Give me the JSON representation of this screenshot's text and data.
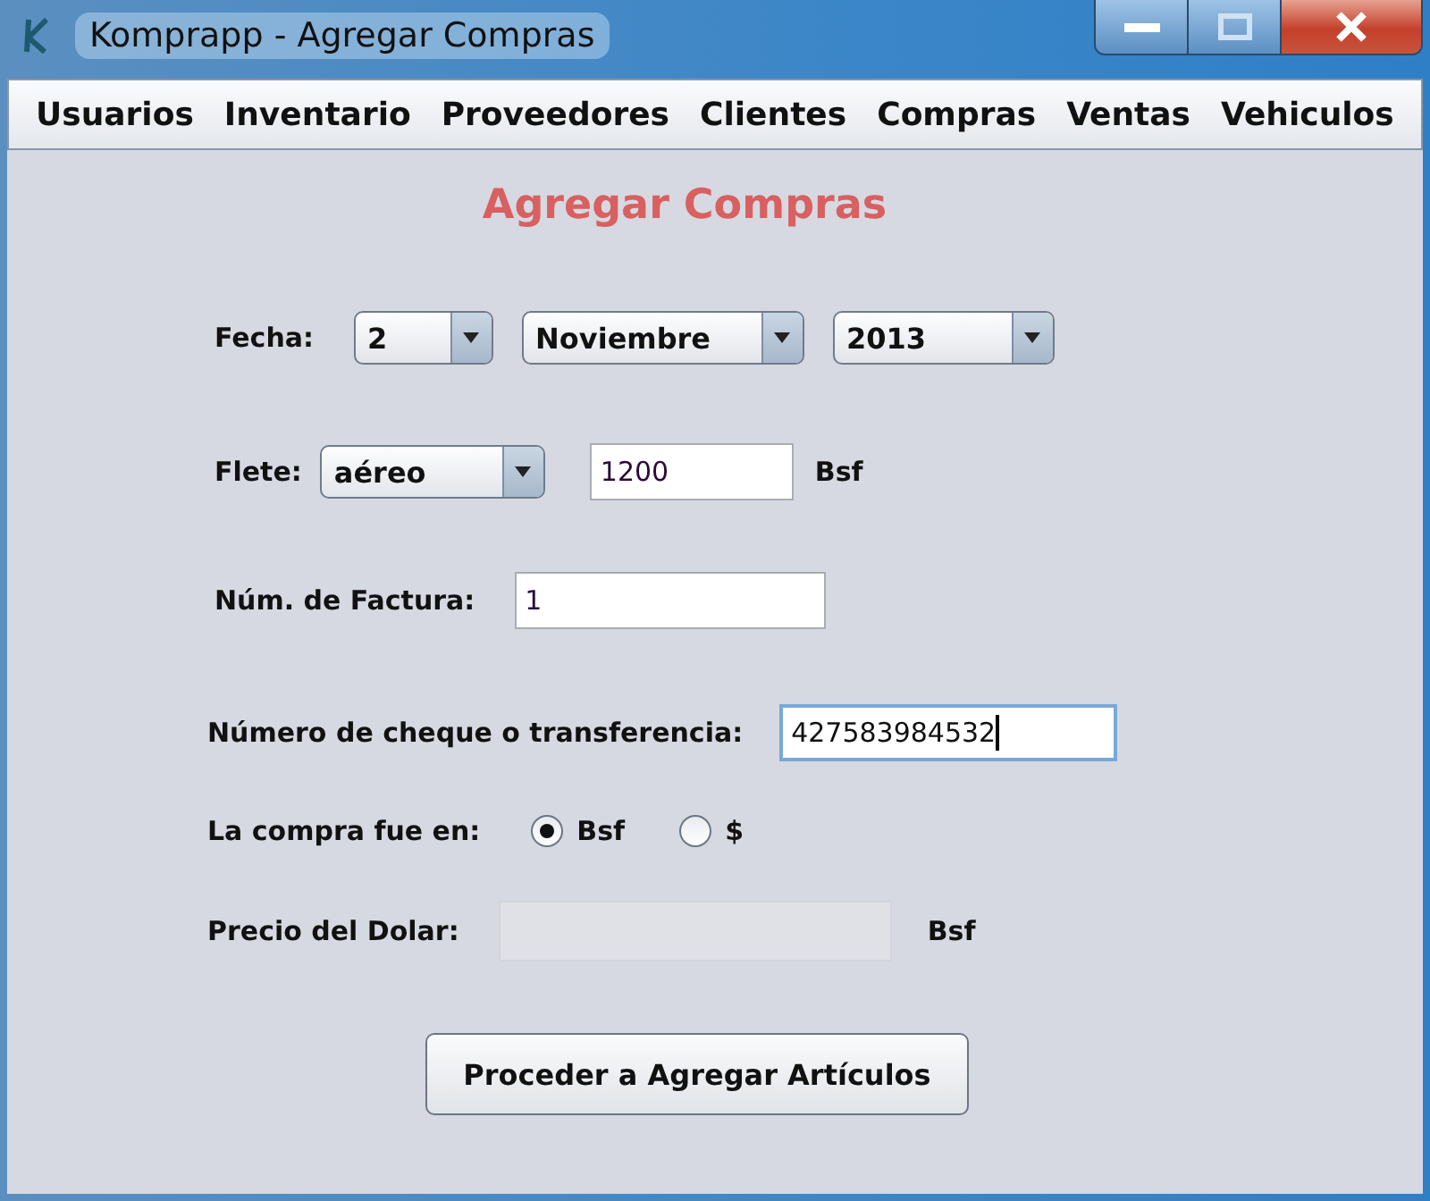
{
  "window": {
    "title": "Komprapp - Agregar Compras"
  },
  "menu": [
    {
      "label": "Usuarios"
    },
    {
      "label": "Inventario"
    },
    {
      "label": "Proveedores"
    },
    {
      "label": "Clientes"
    },
    {
      "label": "Compras"
    },
    {
      "label": "Ventas"
    },
    {
      "label": "Vehiculos"
    }
  ],
  "heading": "Agregar Compras",
  "fecha": {
    "label": "Fecha:",
    "day": "2",
    "month": "Noviembre",
    "year": "2013"
  },
  "flete": {
    "label": "Flete:",
    "type": "aéreo",
    "amount": "1200",
    "unit": "Bsf"
  },
  "factura": {
    "label": "Núm. de Factura:",
    "value": "1"
  },
  "cheque": {
    "label": "Número de cheque o transferencia:",
    "value": "427583984532",
    "focused": true
  },
  "moneda": {
    "label": "La compra fue en:",
    "options": [
      {
        "label": "Bsf",
        "selected": true
      },
      {
        "label": "$",
        "selected": false
      }
    ]
  },
  "dolar": {
    "label": "Precio del Dolar:",
    "disabled": true,
    "unit": "Bsf"
  },
  "button": "Proceder a Agregar Artículos"
}
